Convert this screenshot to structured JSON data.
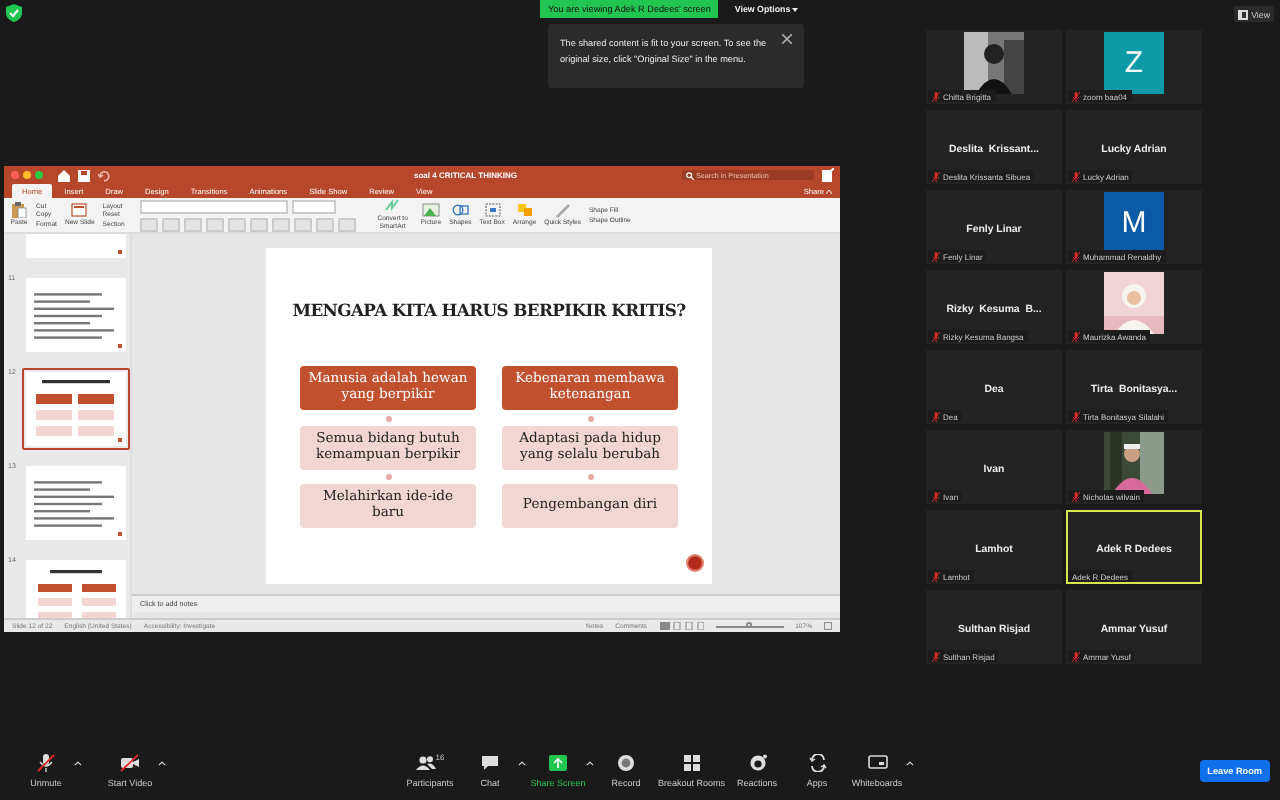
{
  "top_bar": {
    "banner": "You are viewing Adek R Dedees' screen",
    "view_options": "View Options",
    "view_button": "View"
  },
  "notice": {
    "text": "The shared content is fit to your screen. To see the original size, click \"Original Size\" in the menu."
  },
  "app": {
    "title": "soal 4 CRITICAL THINKING",
    "search_placeholder": "Search in Presentation",
    "share": "Share",
    "tabs": [
      {
        "label": "Home",
        "selected": true
      },
      {
        "label": "Insert",
        "selected": false
      },
      {
        "label": "Draw",
        "selected": false
      },
      {
        "label": "Design",
        "selected": false
      },
      {
        "label": "Transitions",
        "selected": false
      },
      {
        "label": "Animations",
        "selected": false
      },
      {
        "label": "Slide Show",
        "selected": false
      },
      {
        "label": "Review",
        "selected": false
      },
      {
        "label": "View",
        "selected": false
      }
    ],
    "ribbon": [
      {
        "kind": "big",
        "label": "Paste"
      },
      {
        "kind": "stack",
        "items": [
          "Cut",
          "Copy",
          "Format"
        ]
      },
      {
        "kind": "big",
        "label": "New Slide"
      },
      {
        "kind": "stack",
        "items": [
          "Layout",
          "Reset",
          "Section"
        ]
      },
      {
        "kind": "font"
      },
      {
        "kind": "big",
        "label": "Convert to SmartArt"
      },
      {
        "kind": "big",
        "label": "Picture"
      },
      {
        "kind": "big",
        "label": "Shapes"
      },
      {
        "kind": "big",
        "label": "Text Box"
      },
      {
        "kind": "big",
        "label": "Arrange"
      },
      {
        "kind": "big",
        "label": "Quick Styles"
      },
      {
        "kind": "stack",
        "items": [
          "Shape Fill",
          "Shape Outline"
        ]
      }
    ],
    "thumbnails": [
      {
        "kind": "partial",
        "selected": false
      },
      {
        "number": "11",
        "kind": "text",
        "selected": false
      },
      {
        "number": "12",
        "kind": "grid",
        "selected": true
      },
      {
        "number": "13",
        "kind": "text",
        "selected": false
      },
      {
        "number": "14",
        "kind": "tags",
        "selected": false
      }
    ],
    "slide": {
      "title": "MENGAPA KITA HARUS BERPIKIR KRITIS?",
      "boxes": [
        {
          "text": "Manusia adalah hewan yang berpikir",
          "kind": "dark"
        },
        {
          "text": "Kebenaran membawa ketenangan",
          "kind": "dark"
        },
        {
          "text": "Semua bidang butuh kemampuan berpikir",
          "kind": "light"
        },
        {
          "text": "Adaptasi pada hidup yang selalu berubah",
          "kind": "light"
        },
        {
          "text": "Melahirkan ide-ide baru",
          "kind": "light"
        },
        {
          "text": "Pengembangan diri",
          "kind": "light"
        }
      ]
    },
    "notes_placeholder": "Click to add notes",
    "status": {
      "slide": "Slide 12 of 22",
      "language": "English (United States)",
      "accessibility": "Accessibility: Investigate",
      "notes": "Notes",
      "comments": "Comments",
      "zoom": "107%",
      "zoom_level": {
        "level": 0.5
      }
    }
  },
  "participants": [
    {
      "label": "Chitta Brigitta",
      "muted": true,
      "selected": false
    },
    {
      "kind": "avatar",
      "letter": "Z",
      "color": "#0e9aa7",
      "label": "zoom baa04",
      "muted": true,
      "selected": false
    },
    {
      "kind": "name",
      "display": "Deslita  Krissant...",
      "label": "Deslita Krissanta Sibuea",
      "muted": true,
      "selected": false
    },
    {
      "kind": "name",
      "display": "Lucky Adrian",
      "label": "Lucky Adrian",
      "muted": true,
      "selected": false
    },
    {
      "kind": "name",
      "display": "Fenly Linar",
      "label": "Fenly Linar",
      "muted": true,
      "selected": false
    },
    {
      "kind": "avatar",
      "letter": "M",
      "color": "#0b5aa6",
      "label": "Muhammad Renaldhy",
      "muted": true,
      "selected": false
    },
    {
      "kind": "name",
      "display": "Rizky  Kesuma  B...",
      "label": "Rizky Kesuma Bangsa",
      "muted": true,
      "selected": false
    },
    {
      "label": "Maurizka Awanda",
      "muted": true,
      "selected": false
    },
    {
      "kind": "name",
      "display": "Dea",
      "label": "Dea",
      "muted": true,
      "selected": false
    },
    {
      "kind": "name",
      "display": "Tirta  Bonitasya...",
      "label": "Tirta Bonitasya Silalahi",
      "muted": true,
      "selected": false
    },
    {
      "kind": "name",
      "display": "Ivan",
      "label": "Ivan",
      "muted": true,
      "selected": false
    },
    {
      "label": "Nicholas wilvain",
      "muted": true,
      "selected": false
    },
    {
      "kind": "name",
      "display": "Lamhot",
      "label": "Lamhot",
      "muted": true,
      "selected": false
    },
    {
      "kind": "name",
      "display": "Adek R Dedees",
      "label": "Adek R Dedees",
      "muted": false,
      "selected": true
    },
    {
      "kind": "name",
      "display": "Sulthan Risjad",
      "label": "Sulthan Risjad",
      "muted": true,
      "selected": false
    },
    {
      "kind": "name",
      "display": "Ammar Yusuf",
      "label": "Ammar Yusuf",
      "muted": true,
      "selected": false
    }
  ],
  "toolbar": {
    "left": [
      {
        "kind": "mic",
        "label": "Unmute",
        "caret": true
      },
      {
        "kind": "video",
        "label": "Start Video",
        "caret": true
      }
    ],
    "center": [
      {
        "kind": "participants",
        "label": "Participants",
        "count": "16",
        "caret": false
      },
      {
        "kind": "chat",
        "label": "Chat",
        "caret": true
      },
      {
        "kind": "share",
        "label": "Share Screen",
        "caret": true
      },
      {
        "kind": "record",
        "label": "Record",
        "caret": false
      },
      {
        "kind": "breakout",
        "label": "Breakout Rooms",
        "caret": false
      },
      {
        "kind": "reactions",
        "label": "Reactions",
        "caret": false
      },
      {
        "kind": "apps",
        "label": "Apps",
        "caret": false
      },
      {
        "kind": "whiteboard",
        "label": "Whiteboards",
        "caret": true
      }
    ],
    "leave": "Leave Room"
  }
}
